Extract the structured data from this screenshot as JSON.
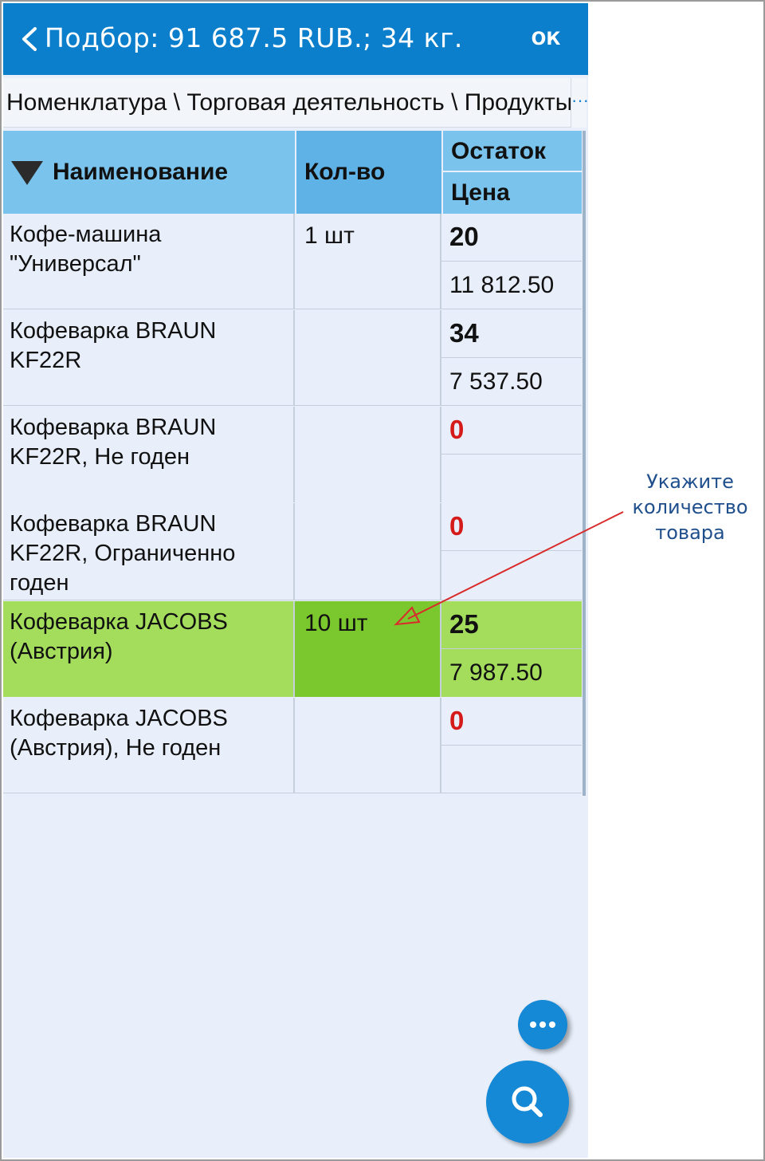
{
  "appbar": {
    "title": "Подбор: 91 687.5 RUB.; 34 кг.",
    "ok_label": "ОК",
    "back_icon": "chevron-left-icon",
    "background": "#0b7ecc"
  },
  "breadcrumb": {
    "text": "Номенклатура \\ Торговая деятельность \\ Продукты",
    "more": "···"
  },
  "table": {
    "headers": {
      "name": "Наименование",
      "qty": "Кол-во",
      "stock": "Остаток",
      "price": "Цена"
    },
    "sort_icon": "sort-descending-icon",
    "rows": [
      {
        "name": "Кофе-машина \"Универсал\"",
        "qty": "1 шт",
        "stock": "20",
        "price": "11 812.50"
      },
      {
        "name": "Кофеварка BRAUN KF22R",
        "qty": "",
        "stock": "34",
        "price": "7 537.50"
      },
      {
        "name": "Кофеварка BRAUN KF22R, Не годен",
        "qty": "",
        "stock": "0",
        "price": ""
      },
      {
        "name": "Кофеварка BRAUN KF22R, Ограниченно годен",
        "qty": "",
        "stock": "0",
        "price": ""
      },
      {
        "name": "Кофеварка JACOBS (Австрия)",
        "qty": "10 шт",
        "stock": "25",
        "price": "7 987.50",
        "selected": true
      },
      {
        "name": "Кофеварка JACOBS (Австрия), Не годен",
        "qty": "",
        "stock": "0",
        "price": ""
      }
    ],
    "selected_color": "#a4dd5c",
    "zero_stock_color": "#d51a1a"
  },
  "fabs": {
    "more_icon": "more-horizontal-icon",
    "search_icon": "search-icon"
  },
  "callout": {
    "line1": "Укажите",
    "line2": "количество",
    "line3": "товара",
    "color": "#1f4f8c",
    "arrow_color": "#d92b2b"
  }
}
